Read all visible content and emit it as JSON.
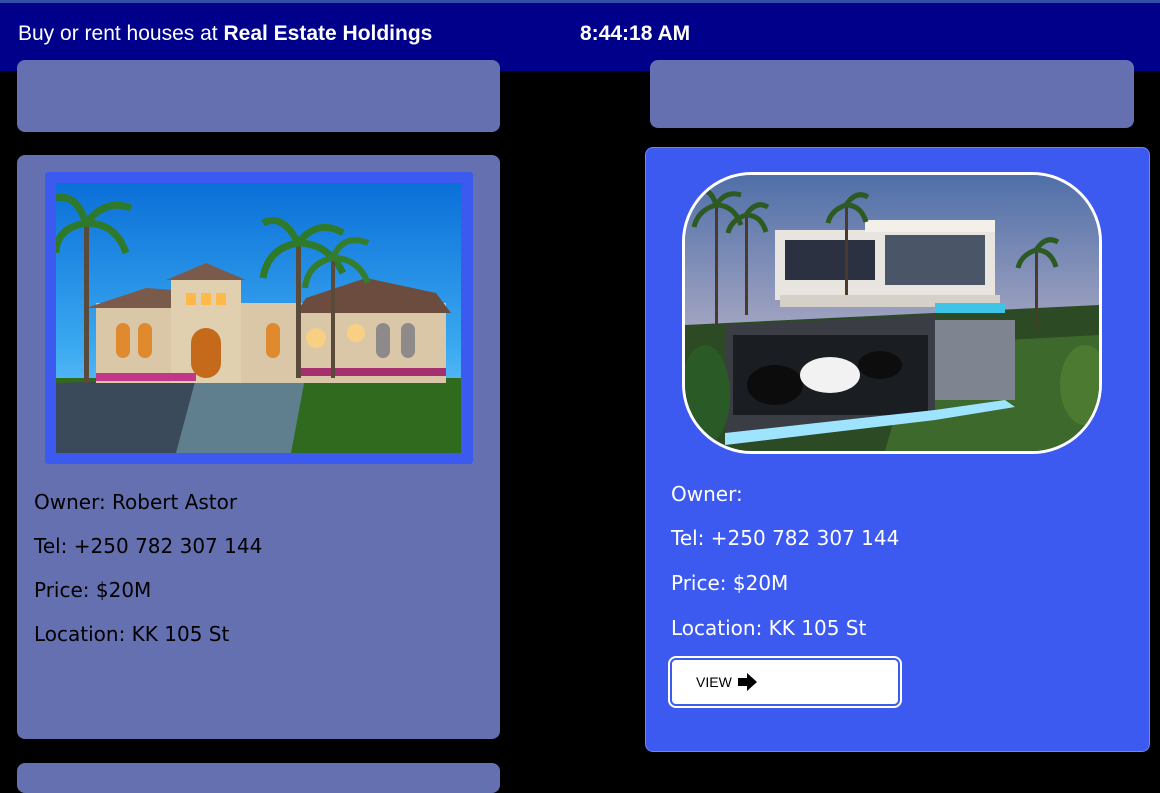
{
  "header": {
    "tagline_prefix": "Buy or rent houses at",
    "brand": "Real Estate Holdings",
    "clock": "8:44:18 AM"
  },
  "listings": [
    {
      "owner": "Owner: Robert Astor",
      "tel": "Tel: +250 782 307 144",
      "price": "Price: $20M",
      "location": "Location: KK 105 St",
      "image": "mediterranean-villa-photo"
    },
    {
      "owner": "Owner:",
      "tel": "Tel: +250 782 307 144",
      "price": "Price: $20M",
      "location": "Location: KK 105 St",
      "image": "modern-mansion-photo",
      "view_label": "VIEW",
      "view_icon": "arrow-right-icon"
    }
  ],
  "colors": {
    "header_bg": "#00008b",
    "card_bg": "#6570b0",
    "active_card_bg": "#3c5af0",
    "page_bg": "#000000"
  }
}
